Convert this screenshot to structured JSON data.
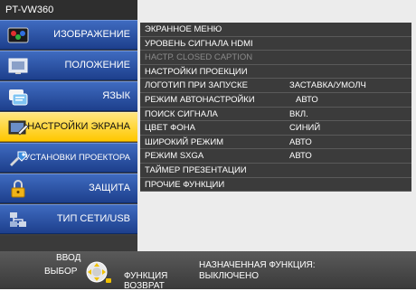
{
  "model": "PT-VW360",
  "sidebar": {
    "items": [
      {
        "label": "ИЗОБРАЖЕНИЕ",
        "icon": "picture-icon"
      },
      {
        "label": "ПОЛОЖЕНИЕ",
        "icon": "position-icon"
      },
      {
        "label": "ЯЗЫК",
        "icon": "language-icon"
      },
      {
        "label": "НАСТРОЙКИ ЭКРАНА",
        "icon": "display-settings-icon",
        "active": true
      },
      {
        "label": "УСТАНОВКИ ПРОЕКТОРА",
        "icon": "projector-setup-icon"
      },
      {
        "label": "ЗАЩИТА",
        "icon": "lock-icon"
      },
      {
        "label": "ТИП СЕТИ/USB",
        "icon": "network-icon"
      }
    ]
  },
  "submenu": {
    "rows": [
      {
        "label": "ЭКРАННОЕ МЕНЮ",
        "value": ""
      },
      {
        "label": "УРОВЕНЬ СИГНАЛА HDMI",
        "value": ""
      },
      {
        "label": "НАСТР. CLOSED CAPTION",
        "value": "",
        "disabled": true
      },
      {
        "label": "НАСТРОЙКИ ПРОЕКЦИИ",
        "value": ""
      },
      {
        "label": "ЛОГОТИП ПРИ ЗАПУСКЕ",
        "value": "ЗАСТАВКА/УМОЛЧ"
      },
      {
        "label": "РЕЖИМ АВТОНАСТРОЙКИ",
        "value": "АВТО"
      },
      {
        "label": "ПОИСК СИГНАЛА",
        "value": "ВКЛ."
      },
      {
        "label": "ЦВЕТ ФОНА",
        "value": "СИНИЙ"
      },
      {
        "label": "ШИРОКИЙ РЕЖИМ",
        "value": "АВТО"
      },
      {
        "label": "РЕЖИМ SXGA",
        "value": "АВТО"
      },
      {
        "label": "ТАЙМЕР ПРЕЗЕНТАЦИИ",
        "value": ""
      },
      {
        "label": "ПРОЧИЕ ФУНКЦИИ",
        "value": ""
      }
    ]
  },
  "bottom": {
    "enter_label": "ВВОД",
    "select_label": "ВЫБОР",
    "function_label": "ФУНКЦИЯ",
    "return_label": "ВОЗВРАТ",
    "assigned_function_label": "НАЗНАЧЕННАЯ ФУНКЦИЯ:",
    "assigned_function_value": "ВЫКЛЮЧЕНО"
  },
  "colors": {
    "sidebar_item": "#2c56ad",
    "sidebar_active": "#ffd21f",
    "submenu_bg": "#3b3b3b",
    "panel_bg": "#ececec"
  }
}
